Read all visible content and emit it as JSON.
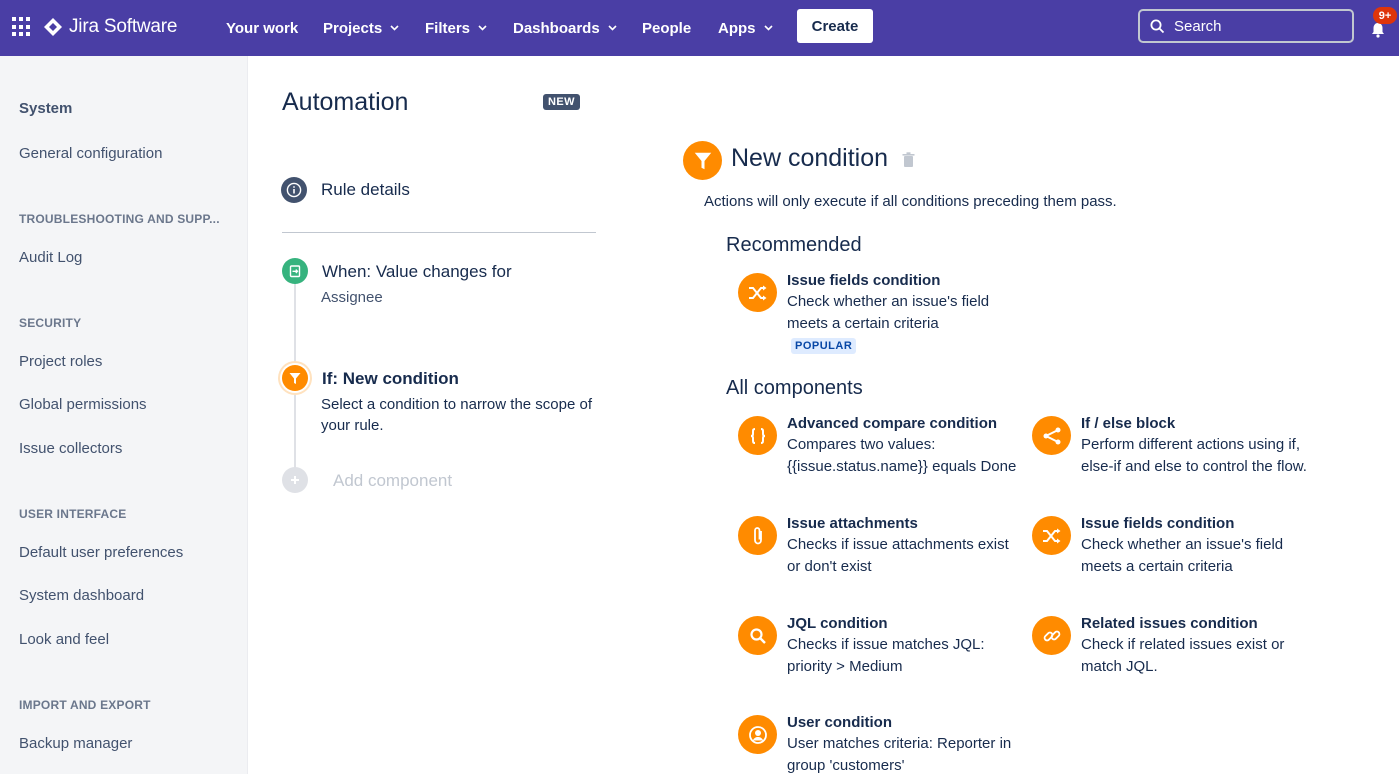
{
  "topnav": {
    "brand": "Jira Software",
    "items": [
      {
        "label": "Your work",
        "dropdown": false
      },
      {
        "label": "Projects",
        "dropdown": true
      },
      {
        "label": "Filters",
        "dropdown": true
      },
      {
        "label": "Dashboards",
        "dropdown": true
      },
      {
        "label": "People",
        "dropdown": false
      },
      {
        "label": "Apps",
        "dropdown": true
      }
    ],
    "create_label": "Create",
    "search_placeholder": "Search",
    "notification_count": "9+",
    "colors": {
      "bar": "#4a3ea5",
      "badge": "#de350b"
    }
  },
  "sidebar": {
    "title": "System",
    "general": "General configuration",
    "sections": [
      {
        "heading": "TROUBLESHOOTING AND SUPP...",
        "items": [
          "Audit Log"
        ]
      },
      {
        "heading": "SECURITY",
        "items": [
          "Project roles",
          "Global permissions",
          "Issue collectors"
        ]
      },
      {
        "heading": "USER INTERFACE",
        "items": [
          "Default user preferences",
          "System dashboard",
          "Look and feel"
        ]
      },
      {
        "heading": "IMPORT AND EXPORT",
        "items": [
          "Backup manager"
        ]
      }
    ]
  },
  "automation": {
    "title": "Automation",
    "badge": "NEW",
    "rule_details": "Rule details",
    "trigger": {
      "title": "When: Value changes for",
      "subtitle": "Assignee"
    },
    "condition_step": {
      "title": "If: New condition",
      "subtitle": "Select a condition to narrow the scope of your rule."
    },
    "add_component": "Add component"
  },
  "condition": {
    "title": "New condition",
    "description": "Actions will only execute if all conditions preceding them pass.",
    "recommended_heading": "Recommended",
    "recommended": {
      "name": "Issue fields condition",
      "desc": "Check whether an issue's field meets a certain criteria",
      "badge": "POPULAR",
      "icon": "shuffle-icon"
    },
    "all_heading": "All components",
    "components": [
      {
        "name": "Advanced compare condition",
        "desc": "Compares two values: {{issue.status.name}} equals Done",
        "icon": "braces-icon"
      },
      {
        "name": "If / else block",
        "desc": "Perform different actions using if, else-if and else to control the flow.",
        "icon": "branch-icon"
      },
      {
        "name": "Issue attachments",
        "desc": "Checks if issue attachments exist or don't exist",
        "icon": "paperclip-icon"
      },
      {
        "name": "Issue fields condition",
        "desc": "Check whether an issue's field meets a certain criteria",
        "icon": "shuffle-icon"
      },
      {
        "name": "JQL condition",
        "desc": "Checks if issue matches JQL: priority > Medium",
        "icon": "search-icon"
      },
      {
        "name": "Related issues condition",
        "desc": "Check if related issues exist or match JQL.",
        "icon": "link-icon"
      },
      {
        "name": "User condition",
        "desc": "User matches criteria: Reporter in group 'customers'",
        "icon": "user-icon"
      }
    ],
    "accent_color": "#ff8b00"
  }
}
